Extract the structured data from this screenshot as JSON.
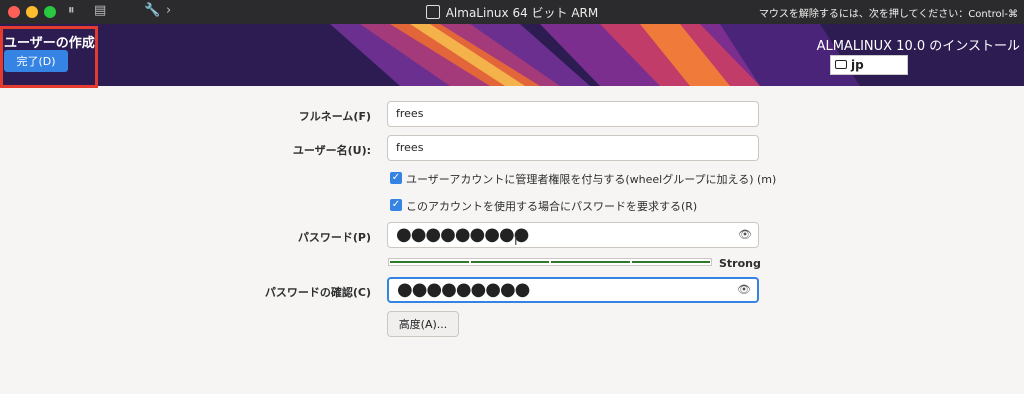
{
  "window": {
    "title": "AlmaLinux 64 ビット ARM",
    "hint": "マウスを解除するには、次を押してください：Control-⌘"
  },
  "header": {
    "spoke_title": "ユーザーの作成",
    "done_label": "完了(D)",
    "install_title": "ALMALINUX 10.0 のインストール",
    "keyboard_layout": "jp"
  },
  "form": {
    "fullname_label": "フルネーム(F)",
    "fullname_value": "frees",
    "username_label": "ユーザー名(U):",
    "username_value": "frees",
    "admin_checkbox_label": "ユーザーアカウントに管理者権限を付与する(wheelグループに加える) (m)",
    "admin_checked": true,
    "require_password_label": "このアカウントを使用する場合にパスワードを要求する(R)",
    "require_password_checked": true,
    "password_label": "パスワード(P)",
    "password_masked": "●●●●●●●●●",
    "password_strength": "Strong",
    "password_strength_level": 1.0,
    "confirm_label": "パスワードの確認(C)",
    "confirm_masked": "●●●●●●●●●",
    "advanced_label": "高度(A)..."
  },
  "colors": {
    "accent": "#3584e4",
    "highlight_box": "#e33b2e",
    "strength_bar": "#2d7a2d"
  }
}
